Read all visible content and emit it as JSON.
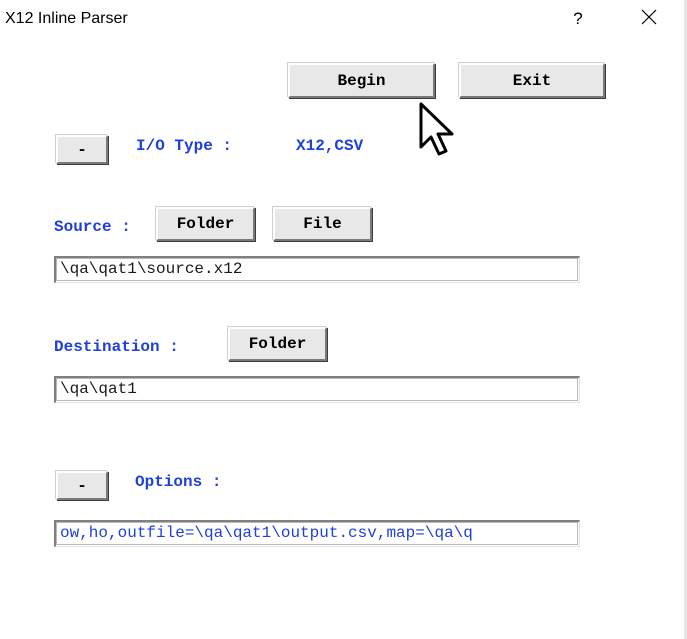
{
  "window": {
    "title": "X12 Inline Parser",
    "help_label": "?",
    "close_label": "✕"
  },
  "toolbar": {
    "begin_label": "Begin",
    "exit_label": "Exit"
  },
  "io": {
    "collapse_label": "-",
    "label": "I/O Type :",
    "value": "X12,CSV"
  },
  "source": {
    "label": "Source :",
    "folder_label": "Folder",
    "file_label": "File",
    "path": "\\qa\\qat1\\source.x12"
  },
  "destination": {
    "label": "Destination :",
    "folder_label": "Folder",
    "path": "\\qa\\qat1"
  },
  "options": {
    "collapse_label": "-",
    "label": "Options :",
    "value": "ow,ho,outfile=\\qa\\qat1\\output.csv,map=\\qa\\q"
  },
  "icons": {
    "mouse_cursor": "arrow-pointer-icon"
  },
  "colors": {
    "label_blue": "#1f3fdc",
    "button_face": "#e8e8e8"
  }
}
